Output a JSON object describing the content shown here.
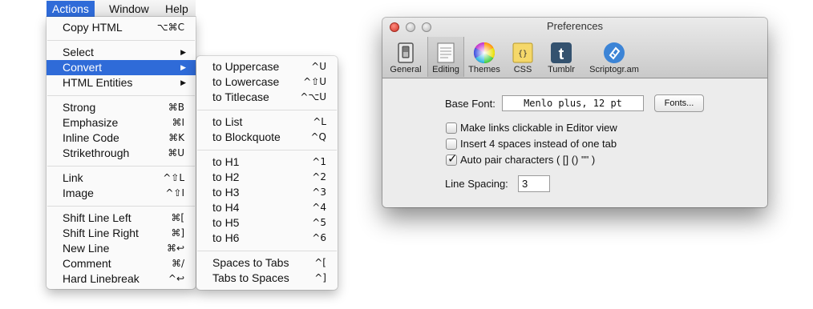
{
  "menubar": {
    "items": [
      {
        "label": "Actions"
      },
      {
        "label": "Window"
      },
      {
        "label": "Help"
      }
    ]
  },
  "actions_menu": {
    "items": [
      {
        "label": "Copy HTML",
        "shortcut": "⌥⌘C"
      },
      {
        "label": "Select",
        "submenu": true
      },
      {
        "label": "Convert",
        "submenu": true,
        "highlighted": true
      },
      {
        "label": "HTML Entities",
        "submenu": true
      },
      {
        "label": "Strong",
        "shortcut": "⌘B"
      },
      {
        "label": "Emphasize",
        "shortcut": "⌘I"
      },
      {
        "label": "Inline Code",
        "shortcut": "⌘K"
      },
      {
        "label": "Strikethrough",
        "shortcut": "⌘U"
      },
      {
        "label": "Link",
        "shortcut": "^⇧L"
      },
      {
        "label": "Image",
        "shortcut": "^⇧I"
      },
      {
        "label": "Shift Line Left",
        "shortcut": "⌘["
      },
      {
        "label": "Shift Line Right",
        "shortcut": "⌘]"
      },
      {
        "label": "New Line",
        "shortcut": "⌘↩"
      },
      {
        "label": "Comment",
        "shortcut": "⌘/"
      },
      {
        "label": "Hard Linebreak",
        "shortcut": "^↩"
      }
    ]
  },
  "convert_menu": {
    "items": [
      {
        "label": "to Uppercase",
        "shortcut": "^U"
      },
      {
        "label": "to Lowercase",
        "shortcut": "^⇧U"
      },
      {
        "label": "to Titlecase",
        "shortcut": "^⌥U"
      },
      {
        "label": "to List",
        "shortcut": "^L"
      },
      {
        "label": "to Blockquote",
        "shortcut": "^Q"
      },
      {
        "label": "to H1",
        "shortcut": "^1"
      },
      {
        "label": "to H2",
        "shortcut": "^2"
      },
      {
        "label": "to H3",
        "shortcut": "^3"
      },
      {
        "label": "to H4",
        "shortcut": "^4"
      },
      {
        "label": "to H5",
        "shortcut": "^5"
      },
      {
        "label": "to H6",
        "shortcut": "^6"
      },
      {
        "label": "Spaces to Tabs",
        "shortcut": "^["
      },
      {
        "label": "Tabs to Spaces",
        "shortcut": "^]"
      }
    ]
  },
  "preferences": {
    "title": "Preferences",
    "tabs": [
      {
        "label": "General",
        "icon": "switch-icon"
      },
      {
        "label": "Editing",
        "icon": "document-icon",
        "selected": true
      },
      {
        "label": "Themes",
        "icon": "color-wheel-icon"
      },
      {
        "label": "CSS",
        "icon": "css-icon"
      },
      {
        "label": "Tumblr",
        "icon": "tumblr-icon"
      },
      {
        "label": "Scriptogr.am",
        "icon": "scriptogram-icon"
      }
    ],
    "base_font_label": "Base Font:",
    "base_font_value": "Menlo plus, 12 pt",
    "fonts_button": "Fonts...",
    "options": [
      {
        "label": "Make links clickable in Editor view",
        "checked": false
      },
      {
        "label": "Insert 4 spaces instead of one tab",
        "checked": false
      },
      {
        "label": "Auto pair characters ( [] () \"\" )",
        "checked": true
      }
    ],
    "line_spacing_label": "Line Spacing:",
    "line_spacing_value": "3"
  },
  "colors": {
    "menu_highlight": "#2f6bd8",
    "tumblr_blue": "#34526f",
    "scriptogram_blue": "#3c84d6",
    "css_yellow": "#f5d86a"
  }
}
